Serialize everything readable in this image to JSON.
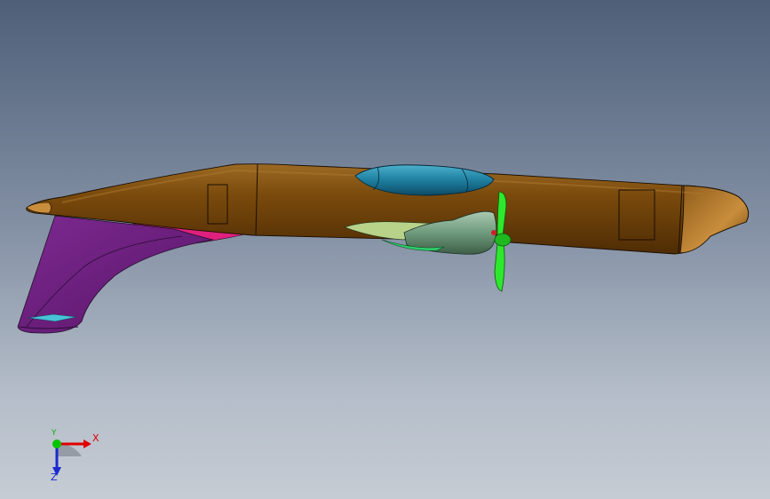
{
  "viewport": {
    "background_top": "#4e5f78",
    "background_bottom": "#c6ccd4"
  },
  "model": {
    "fuselage_color": "#7a4a0c",
    "canopy_color": "#1e7fa0",
    "wing_color": "#6a1c7c",
    "wing_underside_color": "#e0207e",
    "engine_nacelle_color": "#6f9a7c",
    "propeller_color": "#2ee82e"
  },
  "triad": {
    "x_label": "X",
    "y_label": "Y",
    "z_label": "Z",
    "x_color": "#e00000",
    "y_color": "#00b400",
    "z_color": "#1a2ad0"
  }
}
